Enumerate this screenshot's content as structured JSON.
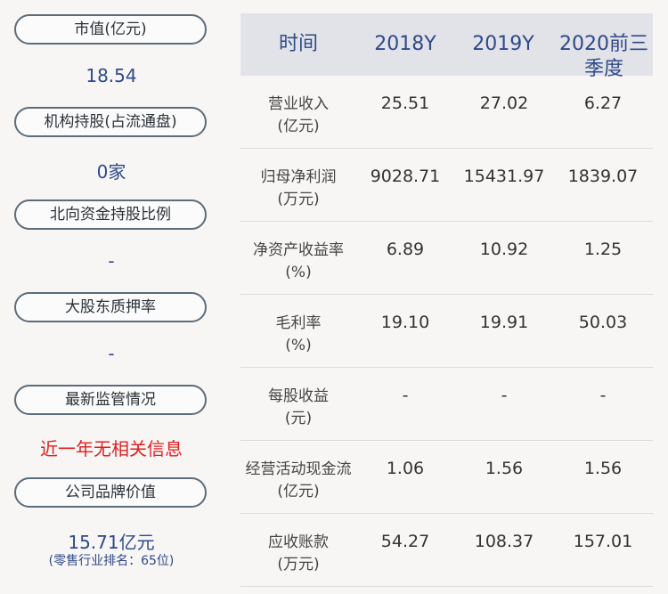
{
  "left": {
    "market_cap_label": "市值(亿元)",
    "market_cap_value": "18.54",
    "inst_label": "机构持股(占流通盘)",
    "inst_value": "0家",
    "north_label": "北向资金持股比例",
    "north_value": "-",
    "pledge_label": "大股东质押率",
    "pledge_value": "-",
    "supervision_label": "最新监管情况",
    "supervision_value": "近一年无相关信息",
    "brand_label": "公司品牌价值",
    "brand_value": "15.71亿元",
    "brand_rank": "(零售行业排名：65位)"
  },
  "table": {
    "headers": [
      "时间",
      "2018Y",
      "2019Y",
      "2020前三季度"
    ],
    "rows": [
      {
        "label1": "营业收入",
        "label2": "(亿元)",
        "values": [
          "25.51",
          "27.02",
          "6.27"
        ]
      },
      {
        "label1": "归母净利润",
        "label2": "(万元)",
        "values": [
          "9028.71",
          "15431.97",
          "1839.07"
        ]
      },
      {
        "label1": "净资产收益率",
        "label2": "(%)",
        "values": [
          "6.89",
          "10.92",
          "1.25"
        ]
      },
      {
        "label1": "毛利率",
        "label2": "(%)",
        "values": [
          "19.10",
          "19.91",
          "50.03"
        ]
      },
      {
        "label1": "每股收益",
        "label2": "(元)",
        "values": [
          "-",
          "-",
          "-"
        ]
      },
      {
        "label1": "经营活动现金流",
        "label2": "(亿元)",
        "values": [
          "1.06",
          "1.56",
          "1.56"
        ]
      },
      {
        "label1": "应收账款",
        "label2": "(万元)",
        "values": [
          "54.27",
          "108.37",
          "157.01"
        ]
      }
    ]
  }
}
